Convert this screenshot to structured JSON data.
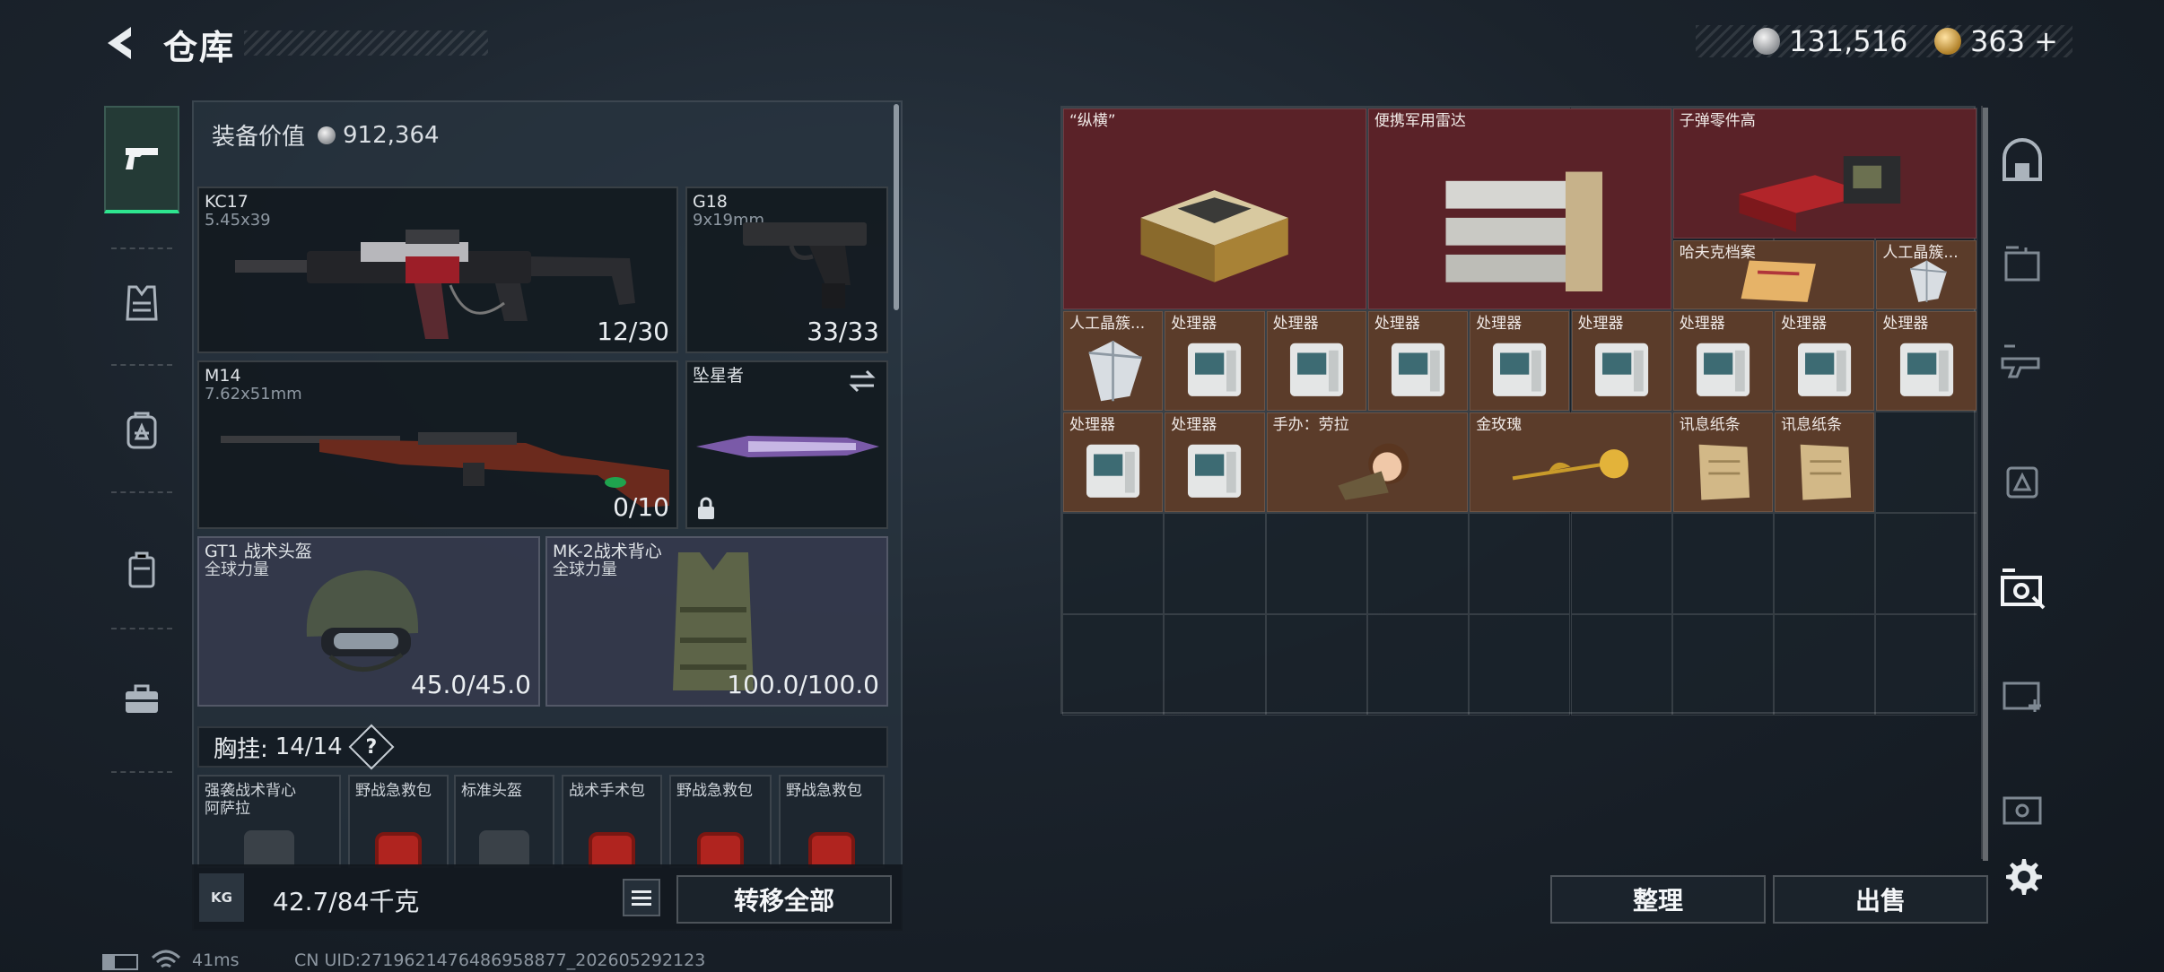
{
  "header": {
    "title": "仓库",
    "currency_silver": "131,516",
    "currency_gold": "363",
    "add_symbol": "+"
  },
  "loadout": {
    "value_label": "装备价值",
    "value": "912,364",
    "primary": {
      "name": "KC17",
      "caliber": "5.45x39",
      "ammo": "12/30"
    },
    "pistol": {
      "name": "G18",
      "caliber": "9x19mm",
      "ammo": "33/33"
    },
    "secondary": {
      "name": "M14",
      "caliber": "7.62x51mm",
      "ammo": "0/10"
    },
    "melee": {
      "name": "坠星者"
    },
    "helmet": {
      "name": "GT1 战术头盔",
      "brand": "全球力量",
      "durability": "45.0/45.0"
    },
    "vest": {
      "name": "MK-2战术背心",
      "brand": "全球力量",
      "durability": "100.0/100.0"
    },
    "chest_rig": {
      "label": "胸挂:",
      "capacity": "14/14",
      "help": "?",
      "items": [
        {
          "name": "强袭战术背心\n阿萨拉"
        },
        {
          "name": "野战急救包"
        },
        {
          "name": "标准头盔"
        },
        {
          "name": "战术手术包"
        },
        {
          "name": "野战急救包"
        },
        {
          "name": "野战急救包"
        }
      ]
    },
    "weight": "42.7/84千克",
    "weight_icon_text": "KG",
    "transfer_all": "转移全部"
  },
  "stash": {
    "items": [
      {
        "name": "“纵横”"
      },
      {
        "name": "便携军用雷达"
      },
      {
        "name": "子弹零件高"
      },
      {
        "name": "哈夫克档案"
      },
      {
        "name": "人工晶簇..."
      },
      {
        "name": "人工晶簇..."
      },
      {
        "name": "处理器"
      },
      {
        "name": "处理器"
      },
      {
        "name": "处理器"
      },
      {
        "name": "处理器"
      },
      {
        "name": "处理器"
      },
      {
        "name": "处理器"
      },
      {
        "name": "处理器"
      },
      {
        "name": "处理器"
      },
      {
        "name": "处理器"
      },
      {
        "name": "处理器"
      },
      {
        "name": "手办：劳拉"
      },
      {
        "name": "金玫瑰"
      },
      {
        "name": "讯息纸条"
      },
      {
        "name": "讯息纸条"
      }
    ],
    "sort_button": "整理",
    "sell_button": "出售"
  },
  "status_bar": {
    "ping": "41ms",
    "uid": "CN UID:2719621476486958877_202605292123"
  },
  "colors": {
    "accent_green": "#2ee58f",
    "valuable_red": "#5a2228",
    "rare_brown": "#5b3c2a"
  },
  "icons": {
    "back": "chevron-left-icon",
    "weapons_tab": "pistol-icon",
    "armor_tab": "vest-icon",
    "backpack_tab": "backpack-icon",
    "pouch_tab": "pouch-icon",
    "case_tab": "briefcase-icon",
    "settings": "gear-icon"
  }
}
